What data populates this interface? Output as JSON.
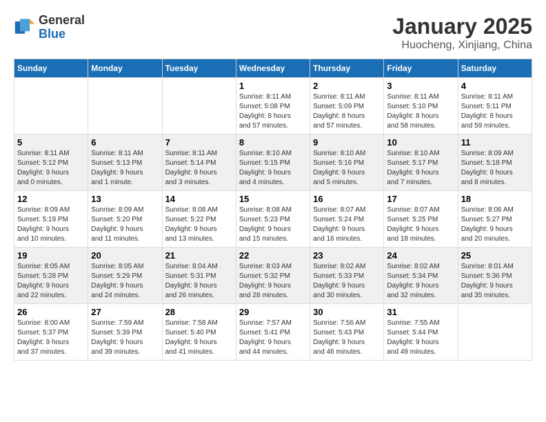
{
  "header": {
    "logo_text_general": "General",
    "logo_text_blue": "Blue",
    "title": "January 2025",
    "subtitle": "Huocheng, Xinjiang, China"
  },
  "weekdays": [
    "Sunday",
    "Monday",
    "Tuesday",
    "Wednesday",
    "Thursday",
    "Friday",
    "Saturday"
  ],
  "weeks": [
    {
      "row_class": "week-row-odd",
      "days": [
        {
          "number": "",
          "info": ""
        },
        {
          "number": "",
          "info": ""
        },
        {
          "number": "",
          "info": ""
        },
        {
          "number": "1",
          "info": "Sunrise: 8:11 AM\nSunset: 5:08 PM\nDaylight: 8 hours\nand 57 minutes."
        },
        {
          "number": "2",
          "info": "Sunrise: 8:11 AM\nSunset: 5:09 PM\nDaylight: 8 hours\nand 57 minutes."
        },
        {
          "number": "3",
          "info": "Sunrise: 8:11 AM\nSunset: 5:10 PM\nDaylight: 8 hours\nand 58 minutes."
        },
        {
          "number": "4",
          "info": "Sunrise: 8:11 AM\nSunset: 5:11 PM\nDaylight: 8 hours\nand 59 minutes."
        }
      ]
    },
    {
      "row_class": "week-row-even",
      "days": [
        {
          "number": "5",
          "info": "Sunrise: 8:11 AM\nSunset: 5:12 PM\nDaylight: 9 hours\nand 0 minutes."
        },
        {
          "number": "6",
          "info": "Sunrise: 8:11 AM\nSunset: 5:13 PM\nDaylight: 9 hours\nand 1 minute."
        },
        {
          "number": "7",
          "info": "Sunrise: 8:11 AM\nSunset: 5:14 PM\nDaylight: 9 hours\nand 3 minutes."
        },
        {
          "number": "8",
          "info": "Sunrise: 8:10 AM\nSunset: 5:15 PM\nDaylight: 9 hours\nand 4 minutes."
        },
        {
          "number": "9",
          "info": "Sunrise: 8:10 AM\nSunset: 5:16 PM\nDaylight: 9 hours\nand 5 minutes."
        },
        {
          "number": "10",
          "info": "Sunrise: 8:10 AM\nSunset: 5:17 PM\nDaylight: 9 hours\nand 7 minutes."
        },
        {
          "number": "11",
          "info": "Sunrise: 8:09 AM\nSunset: 5:18 PM\nDaylight: 9 hours\nand 8 minutes."
        }
      ]
    },
    {
      "row_class": "week-row-odd",
      "days": [
        {
          "number": "12",
          "info": "Sunrise: 8:09 AM\nSunset: 5:19 PM\nDaylight: 9 hours\nand 10 minutes."
        },
        {
          "number": "13",
          "info": "Sunrise: 8:09 AM\nSunset: 5:20 PM\nDaylight: 9 hours\nand 11 minutes."
        },
        {
          "number": "14",
          "info": "Sunrise: 8:08 AM\nSunset: 5:22 PM\nDaylight: 9 hours\nand 13 minutes."
        },
        {
          "number": "15",
          "info": "Sunrise: 8:08 AM\nSunset: 5:23 PM\nDaylight: 9 hours\nand 15 minutes."
        },
        {
          "number": "16",
          "info": "Sunrise: 8:07 AM\nSunset: 5:24 PM\nDaylight: 9 hours\nand 16 minutes."
        },
        {
          "number": "17",
          "info": "Sunrise: 8:07 AM\nSunset: 5:25 PM\nDaylight: 9 hours\nand 18 minutes."
        },
        {
          "number": "18",
          "info": "Sunrise: 8:06 AM\nSunset: 5:27 PM\nDaylight: 9 hours\nand 20 minutes."
        }
      ]
    },
    {
      "row_class": "week-row-even",
      "days": [
        {
          "number": "19",
          "info": "Sunrise: 8:05 AM\nSunset: 5:28 PM\nDaylight: 9 hours\nand 22 minutes."
        },
        {
          "number": "20",
          "info": "Sunrise: 8:05 AM\nSunset: 5:29 PM\nDaylight: 9 hours\nand 24 minutes."
        },
        {
          "number": "21",
          "info": "Sunrise: 8:04 AM\nSunset: 5:31 PM\nDaylight: 9 hours\nand 26 minutes."
        },
        {
          "number": "22",
          "info": "Sunrise: 8:03 AM\nSunset: 5:32 PM\nDaylight: 9 hours\nand 28 minutes."
        },
        {
          "number": "23",
          "info": "Sunrise: 8:02 AM\nSunset: 5:33 PM\nDaylight: 9 hours\nand 30 minutes."
        },
        {
          "number": "24",
          "info": "Sunrise: 8:02 AM\nSunset: 5:34 PM\nDaylight: 9 hours\nand 32 minutes."
        },
        {
          "number": "25",
          "info": "Sunrise: 8:01 AM\nSunset: 5:36 PM\nDaylight: 9 hours\nand 35 minutes."
        }
      ]
    },
    {
      "row_class": "week-row-odd",
      "days": [
        {
          "number": "26",
          "info": "Sunrise: 8:00 AM\nSunset: 5:37 PM\nDaylight: 9 hours\nand 37 minutes."
        },
        {
          "number": "27",
          "info": "Sunrise: 7:59 AM\nSunset: 5:39 PM\nDaylight: 9 hours\nand 39 minutes."
        },
        {
          "number": "28",
          "info": "Sunrise: 7:58 AM\nSunset: 5:40 PM\nDaylight: 9 hours\nand 41 minutes."
        },
        {
          "number": "29",
          "info": "Sunrise: 7:57 AM\nSunset: 5:41 PM\nDaylight: 9 hours\nand 44 minutes."
        },
        {
          "number": "30",
          "info": "Sunrise: 7:56 AM\nSunset: 5:43 PM\nDaylight: 9 hours\nand 46 minutes."
        },
        {
          "number": "31",
          "info": "Sunrise: 7:55 AM\nSunset: 5:44 PM\nDaylight: 9 hours\nand 49 minutes."
        },
        {
          "number": "",
          "info": ""
        }
      ]
    }
  ]
}
